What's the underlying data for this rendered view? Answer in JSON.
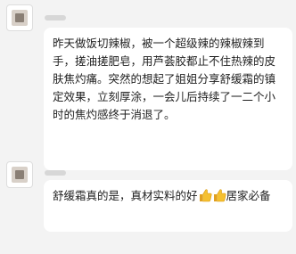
{
  "messages": [
    {
      "text": "昨天做饭切辣椒，被一个超级辣的辣椒辣到手，搓油搓肥皂，用芦荟胶都止不住热辣的皮肤焦灼痛。突然的想起了姐姐分享舒缓霜的镇定效果，立刻厚涂，一会儿后持续了一二个小时的焦灼感终于消退了。"
    },
    {
      "text_before": "舒缓霜真的是，真材实料的好",
      "emoji": [
        "thumbs-up",
        "thumbs-up"
      ],
      "text_after": "居家必备"
    }
  ],
  "colors": {
    "background": "#f3f3f3",
    "bubble": "#ffffff",
    "text": "#1f1f1f",
    "emoji": "#f5c030"
  }
}
